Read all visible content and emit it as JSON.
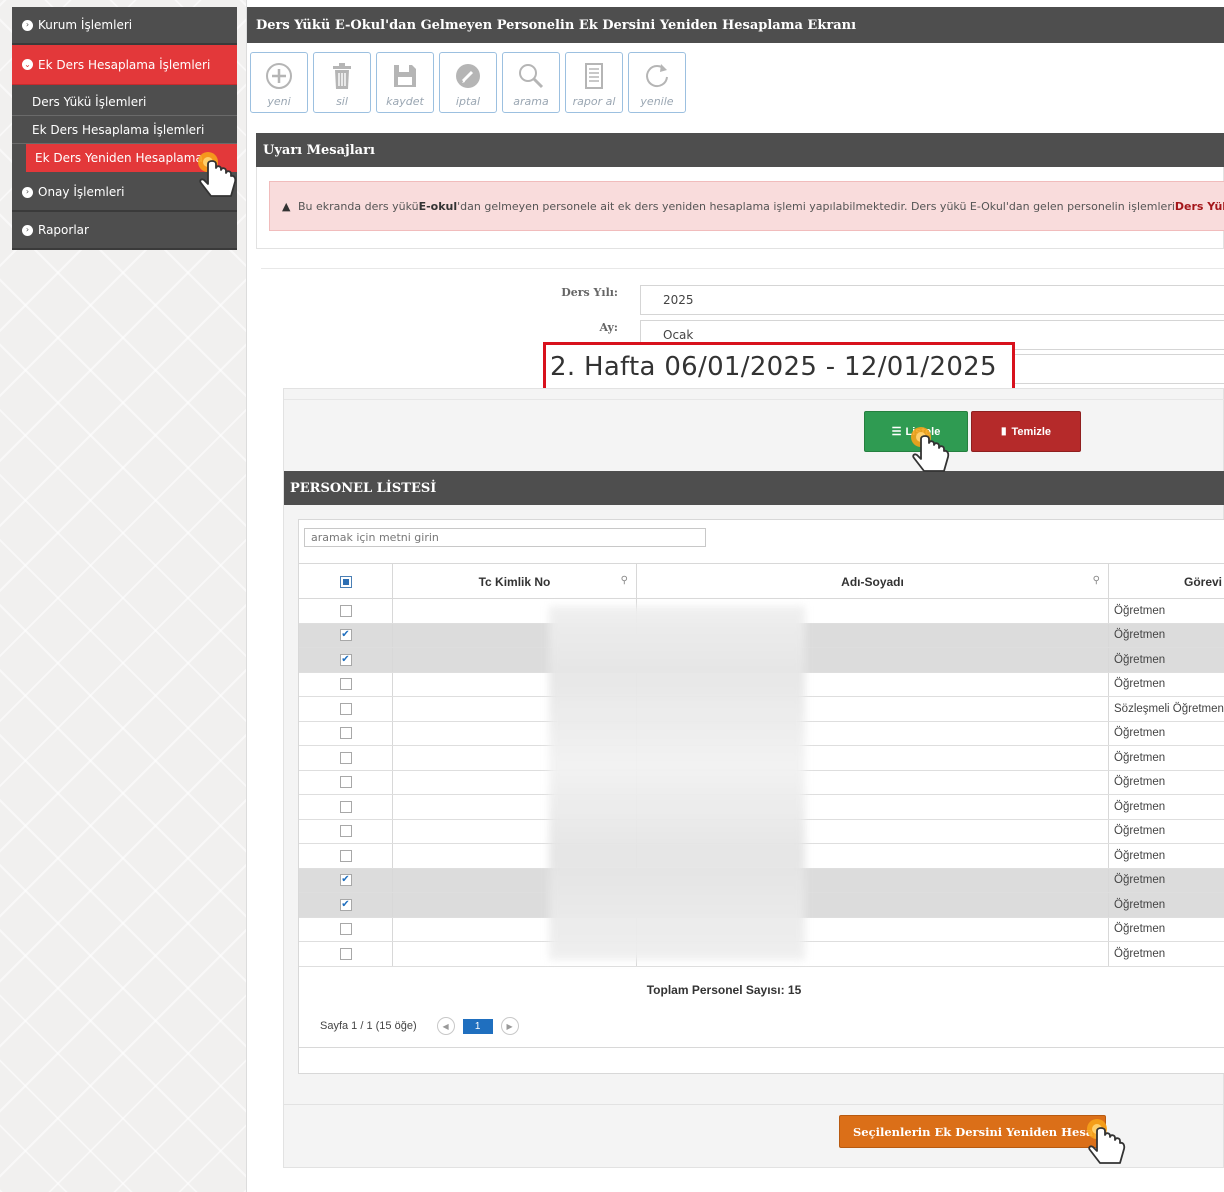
{
  "sidebar": {
    "items": [
      {
        "label": "Kurum İşlemleri"
      },
      {
        "label": "Ek Ders Hesaplama İşlemleri"
      },
      {
        "label": "Onay İşlemleri"
      },
      {
        "label": "Raporlar"
      }
    ],
    "submenu": [
      {
        "label": "Ders Yükü İşlemleri"
      },
      {
        "label": "Ek Ders Hesaplama İşlemleri"
      },
      {
        "label": "Ek Ders Yeniden Hesaplama"
      }
    ]
  },
  "header": {
    "title": "Ders Yükü E-Okul'dan Gelmeyen Personelin Ek Dersini Yeniden Hesaplama Ekranı"
  },
  "toolbar": {
    "buttons": [
      {
        "label": "yeni",
        "icon": "plus-circle-icon"
      },
      {
        "label": "sil",
        "icon": "trash-icon"
      },
      {
        "label": "kaydet",
        "icon": "floppy-icon"
      },
      {
        "label": "iptal",
        "icon": "cancel-icon"
      },
      {
        "label": "arama",
        "icon": "search-icon"
      },
      {
        "label": "rapor al",
        "icon": "report-icon"
      },
      {
        "label": "yenile",
        "icon": "refresh-icon"
      }
    ]
  },
  "warnings": {
    "title": "Uyarı Mesajları",
    "text_1": "Bu ekranda ders yükü ",
    "text_bold": "E-okul",
    "text_2": "'dan gelmeyen personele ait ek ders yeniden hesaplama işlemi yapılabilmektedir. Ders yükü E-Okul'dan gelen personelin işlemleri ",
    "text_red": "Ders Yükü"
  },
  "form": {
    "year_label": "Ders Yılı:",
    "year_value": "2025",
    "month_label": "Ay:",
    "month_value": "Ocak",
    "week_value": "2. Hafta 06/01/2025 - 12/01/2025"
  },
  "buttons": {
    "list": "Listele",
    "clear": "Temizle",
    "recalc": "Seçilenlerin Ek Dersini Yeniden Hesapla"
  },
  "personnel": {
    "title": "PERSONEL LİSTESİ",
    "search_placeholder": "aramak için metni girin",
    "columns": {
      "tc": "Tc Kimlik No",
      "name": "Adı-Soyadı",
      "role": "Görevi"
    },
    "rows": [
      {
        "checked": false,
        "role": "Öğretmen"
      },
      {
        "checked": true,
        "role": "Öğretmen"
      },
      {
        "checked": true,
        "role": "Öğretmen"
      },
      {
        "checked": false,
        "role": "Öğretmen"
      },
      {
        "checked": false,
        "role": "Sözleşmeli Öğretmen"
      },
      {
        "checked": false,
        "role": "Öğretmen"
      },
      {
        "checked": false,
        "role": "Öğretmen"
      },
      {
        "checked": false,
        "role": "Öğretmen"
      },
      {
        "checked": false,
        "role": "Öğretmen"
      },
      {
        "checked": false,
        "role": "Öğretmen"
      },
      {
        "checked": false,
        "role": "Öğretmen"
      },
      {
        "checked": true,
        "role": "Öğretmen"
      },
      {
        "checked": true,
        "role": "Öğretmen"
      },
      {
        "checked": false,
        "role": "Öğretmen"
      },
      {
        "checked": false,
        "role": "Öğretmen"
      }
    ],
    "total": "Toplam Personel Sayısı: 15",
    "pager_text": "Sayfa 1 / 1 (15 öğe)",
    "current_page": "1"
  },
  "colors": {
    "header_bg": "#4e4e4e",
    "active_red": "#e3383a",
    "list_green": "#2f9b52",
    "clear_red": "#b52a2a",
    "recalc_orange": "#db6f18",
    "highlight_border": "#d8111d"
  }
}
